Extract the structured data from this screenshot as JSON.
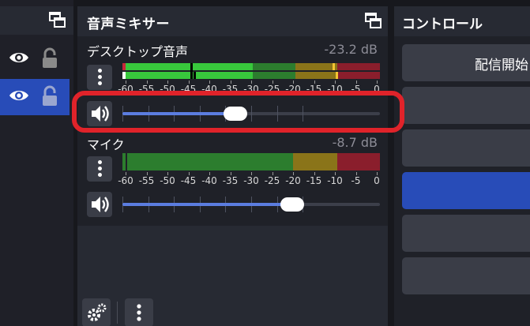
{
  "mixer": {
    "title": "音声ミキサー",
    "channels": [
      {
        "name": "デスクトップ音声",
        "db": "-23.2 dB",
        "volume_fraction": 0.44,
        "muted": false
      },
      {
        "name": "マイク",
        "db": "-8.7 dB",
        "volume_fraction": 0.66,
        "muted": false
      }
    ],
    "scale_labels": [
      "-60",
      "-55",
      "-50",
      "-45",
      "-40",
      "-35",
      "-30",
      "-25",
      "-20",
      "-15",
      "-10",
      "-5",
      "0"
    ],
    "footer": {
      "settings_icon": "gears-icon",
      "menu_icon": "vertical-dots-icon"
    }
  },
  "controls": {
    "title": "コントロール",
    "buttons": [
      {
        "label": "配信開始",
        "active": false
      },
      {
        "label": "",
        "active": false
      },
      {
        "label": "",
        "active": false
      },
      {
        "label": "",
        "active": true
      },
      {
        "label": "",
        "active": false
      },
      {
        "label": "",
        "active": false
      }
    ]
  },
  "sources": {
    "rows": [
      {
        "visible": true,
        "locked": true,
        "selected": false
      },
      {
        "visible": true,
        "locked": true,
        "selected": true
      }
    ]
  },
  "colors": {
    "accent": "#284cb8",
    "highlight": "#e0232a",
    "meter_green": "#38c83c",
    "meter_yellow": "#c8a81c",
    "meter_red": "#c8283a"
  }
}
